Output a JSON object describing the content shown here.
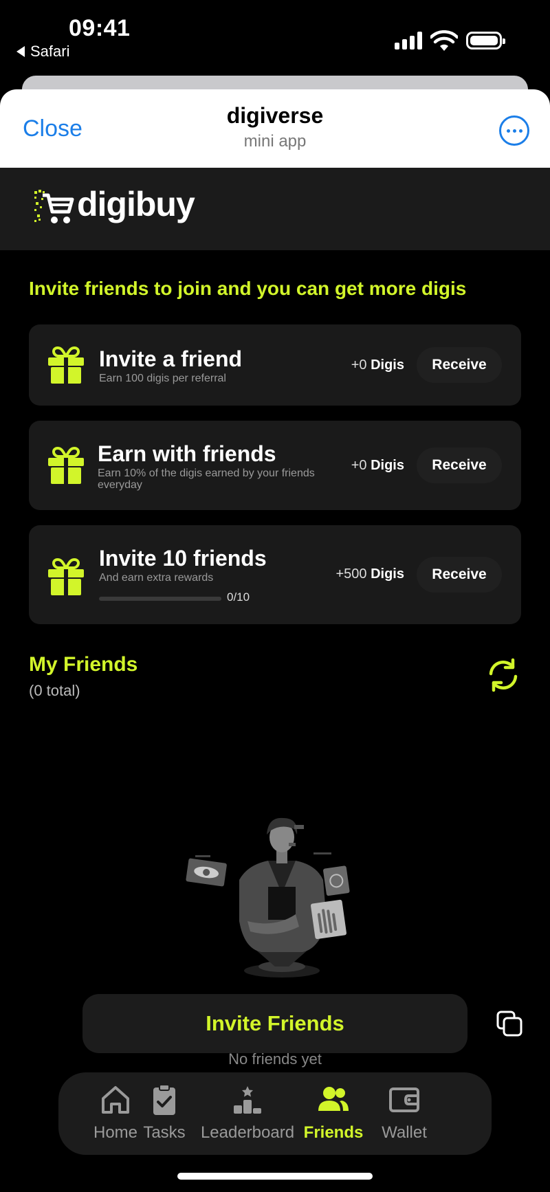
{
  "status_bar": {
    "time": "09:41",
    "back_app": "Safari"
  },
  "header": {
    "close_label": "Close",
    "title": "digiverse",
    "subtitle": "mini app",
    "more_icon": "ellipsis-circle-icon"
  },
  "brand": {
    "name": "digibuy",
    "accent": "#d2f52a"
  },
  "intro_text": "Invite friends to join and you can get more digis",
  "tasks": [
    {
      "title": "Invite a friend",
      "desc": "Earn 100 digis per referral",
      "reward_amount": "+0",
      "reward_unit": "Digis",
      "action": "Receive"
    },
    {
      "title": "Earn with friends",
      "desc": "Earn 10% of the digis earned by your friends everyday",
      "reward_amount": "+0",
      "reward_unit": "Digis",
      "action": "Receive"
    },
    {
      "title": "Invite 10 friends",
      "desc": "And earn extra rewards",
      "reward_amount": "+500",
      "reward_unit": "Digis",
      "action": "Receive",
      "progress_text": "0/10",
      "progress_fraction": 0
    }
  ],
  "friends": {
    "title": "My Friends",
    "count": "(0 total)",
    "empty_text": "No friends yet"
  },
  "invite_button": "Invite Friends",
  "tabs": [
    {
      "label": "Home",
      "icon": "home-icon",
      "active": false
    },
    {
      "label": "Tasks",
      "icon": "clipboard-check-icon",
      "active": false
    },
    {
      "label": "Leaderboard",
      "icon": "podium-icon",
      "active": false
    },
    {
      "label": "Friends",
      "icon": "users-icon",
      "active": true
    },
    {
      "label": "Wallet",
      "icon": "wallet-icon",
      "active": false
    }
  ]
}
